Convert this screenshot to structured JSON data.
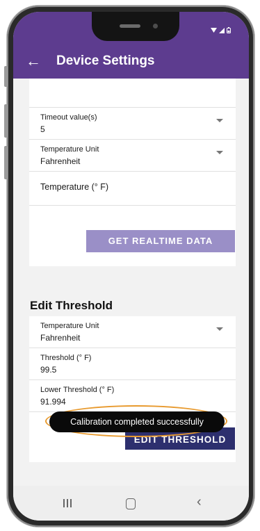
{
  "header": {
    "title": "Device Settings",
    "back_icon": "back-arrow-icon"
  },
  "device_section": {
    "rows": [
      {
        "label": "Timeout value(s)",
        "value": "5"
      },
      {
        "label": "Temperature Unit",
        "value": "Fahrenheit"
      }
    ],
    "temperature_label": "Temperature (° F)",
    "realtime_button": "GET REALTIME DATA"
  },
  "threshold_section": {
    "title": "Edit Threshold",
    "rows": [
      {
        "label": "Temperature Unit",
        "value": "Fahrenheit"
      },
      {
        "label": "Threshold (° F)",
        "value": "99.5"
      },
      {
        "label": "Lower Threshold (° F)",
        "value": "91.994"
      }
    ],
    "edit_button": "EDIT THRESHOLD"
  },
  "toast": {
    "message": "Calibration completed successfully"
  },
  "colors": {
    "brand": "#5d3c8f",
    "button_light": "#9a8fc7",
    "button_dark": "#2d2f6e",
    "highlight": "#e89a2e"
  }
}
